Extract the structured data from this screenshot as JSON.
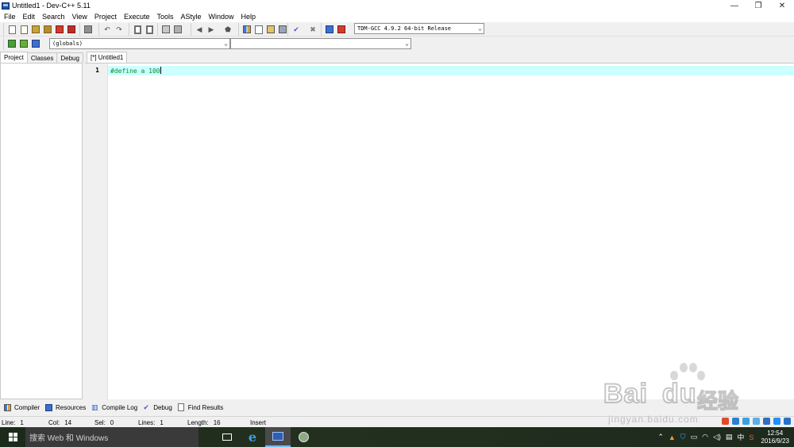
{
  "window": {
    "title": "Untitled1 - Dev-C++ 5.11",
    "controls": {
      "minimize": "—",
      "restore": "❐",
      "close": "✕"
    }
  },
  "menu": [
    "File",
    "Edit",
    "Search",
    "View",
    "Project",
    "Execute",
    "Tools",
    "AStyle",
    "Window",
    "Help"
  ],
  "toolbar": {
    "compiler_select": "TDM-GCC 4.9.2 64-bit Release",
    "scope_select": "(globals)",
    "function_select": ""
  },
  "left_panel": {
    "tabs": [
      "Project",
      "Classes",
      "Debug"
    ],
    "active_tab": "Project"
  },
  "editor": {
    "tab_label": "[*] Untitled1",
    "lines": [
      {
        "number": "1",
        "code": "#define a 100"
      }
    ]
  },
  "bottom_tabs": [
    "Compiler",
    "Resources",
    "Compile Log",
    "Debug",
    "Find Results"
  ],
  "status": {
    "line_label": "Line:",
    "line_value": "1",
    "col_label": "Col:",
    "col_value": "14",
    "sel_label": "Sel:",
    "sel_value": "0",
    "lines_label": "Lines:",
    "lines_value": "1",
    "length_label": "Length:",
    "length_value": "16",
    "mode": "Insert"
  },
  "watermark": {
    "logo": "Bai",
    "logo_suffix": "du",
    "chinese": "经验",
    "sub": "jingyan.baidu.com"
  },
  "taskbar": {
    "search_placeholder": "搜索 Web 和 Windows",
    "ime": "中",
    "clock_time": "12:54",
    "clock_date": "2016/9/23"
  },
  "colors": {
    "code_green": "#0a8a32",
    "current_line": "#ccffff",
    "taskbar": "#1d2a1c"
  }
}
